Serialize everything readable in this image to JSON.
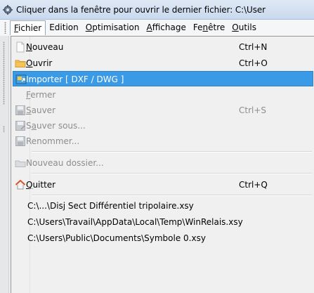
{
  "window": {
    "title": "Cliquer dans la fenêtre pour ouvrir le dernier fichier: C:\\User",
    "app_icon": "app-gear-icon"
  },
  "menubar": {
    "items": [
      {
        "label": "Fichier",
        "open": true
      },
      {
        "label": "Edition"
      },
      {
        "label": "Optimisation"
      },
      {
        "label": "Affichage"
      },
      {
        "label": "Fenêtre"
      },
      {
        "label": "Outils"
      }
    ]
  },
  "file_menu": {
    "items": [
      {
        "label": "Nouveau",
        "shortcut": "Ctrl+N",
        "icon": "new-file-icon",
        "enabled": true
      },
      {
        "label": "Ouvrir",
        "shortcut": "Ctrl+O",
        "icon": "folder-icon",
        "enabled": true
      },
      {
        "label": "Importer  [ DXF / DWG ]",
        "shortcut": "",
        "icon": "import-icon",
        "enabled": true,
        "highlighted": true
      },
      {
        "label": "Fermer",
        "shortcut": "",
        "icon": "",
        "enabled": false
      },
      {
        "label": "Sauver",
        "shortcut": "Ctrl+S",
        "icon": "save-icon",
        "enabled": false
      },
      {
        "label": "Sauver sous...",
        "shortcut": "",
        "icon": "save-as-icon",
        "enabled": false
      },
      {
        "label": "Renommer...",
        "shortcut": "",
        "icon": "rename-icon",
        "enabled": false
      },
      {
        "label": "Nouveau dossier...",
        "shortcut": "",
        "icon": "new-folder-icon",
        "enabled": false
      },
      {
        "label": "Quitter",
        "shortcut": "Ctrl+Q",
        "icon": "home-exit-icon",
        "enabled": true
      }
    ],
    "recent_files": [
      "C:\\...\\Disj Sect Différentiel tripolaire.xsy",
      "C:\\Users\\Travail\\AppData\\Local\\Temp\\WinRelais.xsy",
      "C:\\Users\\Public\\Documents\\Symbole 0.xsy"
    ]
  },
  "colors": {
    "highlight": "#3b9ae6",
    "highlight_border": "#2c82cb",
    "disabled_text": "#8d8d8d"
  }
}
